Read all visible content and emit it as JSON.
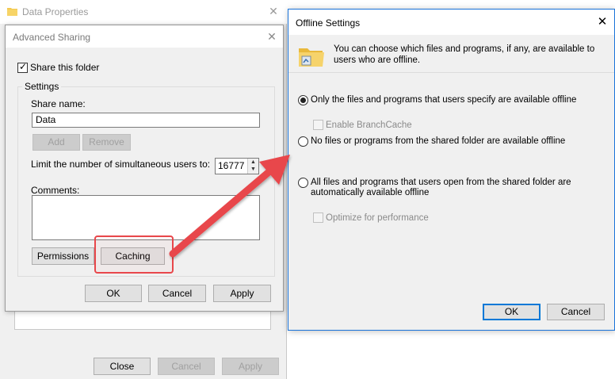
{
  "data_properties": {
    "title": "Data Properties",
    "close_button": "Close",
    "cancel_button": "Cancel",
    "apply_button": "Apply"
  },
  "advanced_sharing": {
    "title": "Advanced Sharing",
    "share_this_folder_label": "Share this folder",
    "share_this_folder_checked": true,
    "settings_legend": "Settings",
    "share_name_label": "Share name:",
    "share_name_value": "Data",
    "add_button": "Add",
    "remove_button": "Remove",
    "limit_users_label": "Limit the number of simultaneous users to:",
    "limit_users_value": "16777",
    "comments_label": "Comments:",
    "comments_value": "",
    "permissions_button": "Permissions",
    "caching_button": "Caching",
    "ok_button": "OK",
    "cancel_button": "Cancel",
    "apply_button": "Apply"
  },
  "offline_settings": {
    "title": "Offline Settings",
    "description": "You can choose which files and programs, if any, are available to users who are offline.",
    "option_only_specified": "Only the files and programs that users specify are available offline",
    "option_enable_branchcache": "Enable BranchCache",
    "option_no_files": "No files or programs from the shared folder are available offline",
    "option_all_files": "All files and programs that users open from the shared folder are automatically available offline",
    "option_optimize": "Optimize for performance",
    "selected_option": "only_specified",
    "ok_button": "OK",
    "cancel_button": "Cancel"
  },
  "annotation": {
    "highlight_color": "#e8474b",
    "arrow_color": "#e8474b"
  }
}
